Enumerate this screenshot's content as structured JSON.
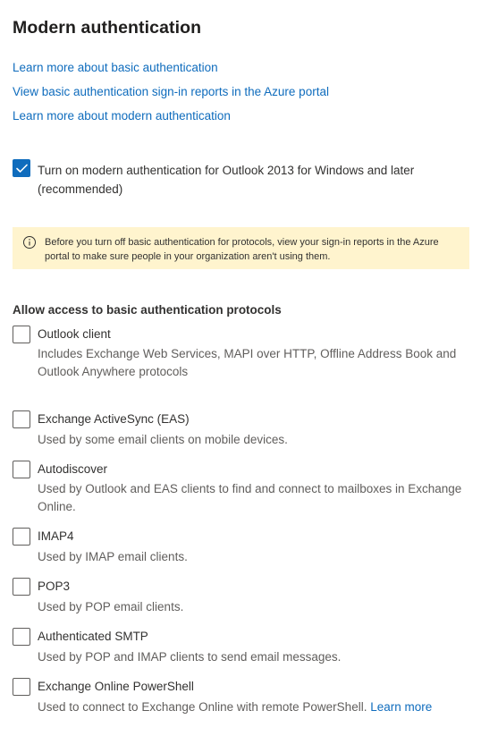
{
  "title": "Modern authentication",
  "links": [
    "Learn more about basic authentication",
    "View basic authentication sign-in reports in the Azure portal",
    "Learn more about modern authentication"
  ],
  "modern_auth": {
    "checked": true,
    "label": "Turn on modern authentication for Outlook 2013 for Windows and later (recommended)"
  },
  "warning": {
    "icon": "info-icon",
    "text": "Before you turn off basic authentication for protocols, view your sign-in reports in the Azure portal to make sure people in your organization aren't using them."
  },
  "protocols_heading": "Allow access to basic authentication protocols",
  "protocols": [
    {
      "label": "Outlook client",
      "checked": false,
      "description": "Includes Exchange Web Services, MAPI over HTTP, Offline Address Book and Outlook Anywhere protocols"
    },
    {
      "label": "Exchange ActiveSync (EAS)",
      "checked": false,
      "description": "Used by some email clients on mobile devices."
    },
    {
      "label": "Autodiscover",
      "checked": false,
      "description": "Used by Outlook and EAS clients to find and connect to mailboxes in Exchange Online."
    },
    {
      "label": "IMAP4",
      "checked": false,
      "description": "Used by IMAP email clients."
    },
    {
      "label": "POP3",
      "checked": false,
      "description": "Used by POP email clients."
    },
    {
      "label": "Authenticated SMTP",
      "checked": false,
      "description": "Used by POP and IMAP clients to send email messages."
    },
    {
      "label": "Exchange Online PowerShell",
      "checked": false,
      "description": "Used to connect to Exchange Online with remote PowerShell.",
      "link": "Learn more"
    }
  ],
  "colors": {
    "link": "#0f6cbd",
    "checkbox_checked": "#0f6cbd",
    "warning_background": "#fff4ce",
    "text": "#323130",
    "secondary_text": "#605e5c"
  }
}
